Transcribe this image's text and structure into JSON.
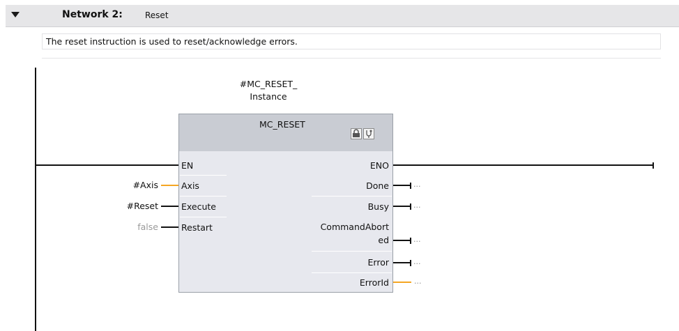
{
  "network": {
    "title": "Network 2:",
    "name": "Reset",
    "comment": "The reset instruction is used to reset/acknowledge errors."
  },
  "block": {
    "instance_line1": "#MC_RESET_",
    "instance_line2": "Instance",
    "type": "MC_RESET",
    "icons": [
      "lock-icon",
      "stethoscope-icon"
    ],
    "inputs": [
      {
        "pin": "EN",
        "param": ""
      },
      {
        "pin": "Axis",
        "param": "#Axis"
      },
      {
        "pin": "Execute",
        "param": "#Reset"
      },
      {
        "pin": "Restart",
        "param": "false"
      }
    ],
    "outputs": [
      {
        "pin": "ENO",
        "value": ""
      },
      {
        "pin": "Done",
        "value": "..."
      },
      {
        "pin": "Busy",
        "value": "..."
      },
      {
        "pin": "CommandAbort",
        "value": ""
      },
      {
        "pin": "ed",
        "value": "..."
      },
      {
        "pin": "Error",
        "value": "..."
      },
      {
        "pin": "ErrorId",
        "value": "..."
      }
    ]
  },
  "colors": {
    "bool_wire": "#111111",
    "struct_wire": "#f5a623"
  }
}
